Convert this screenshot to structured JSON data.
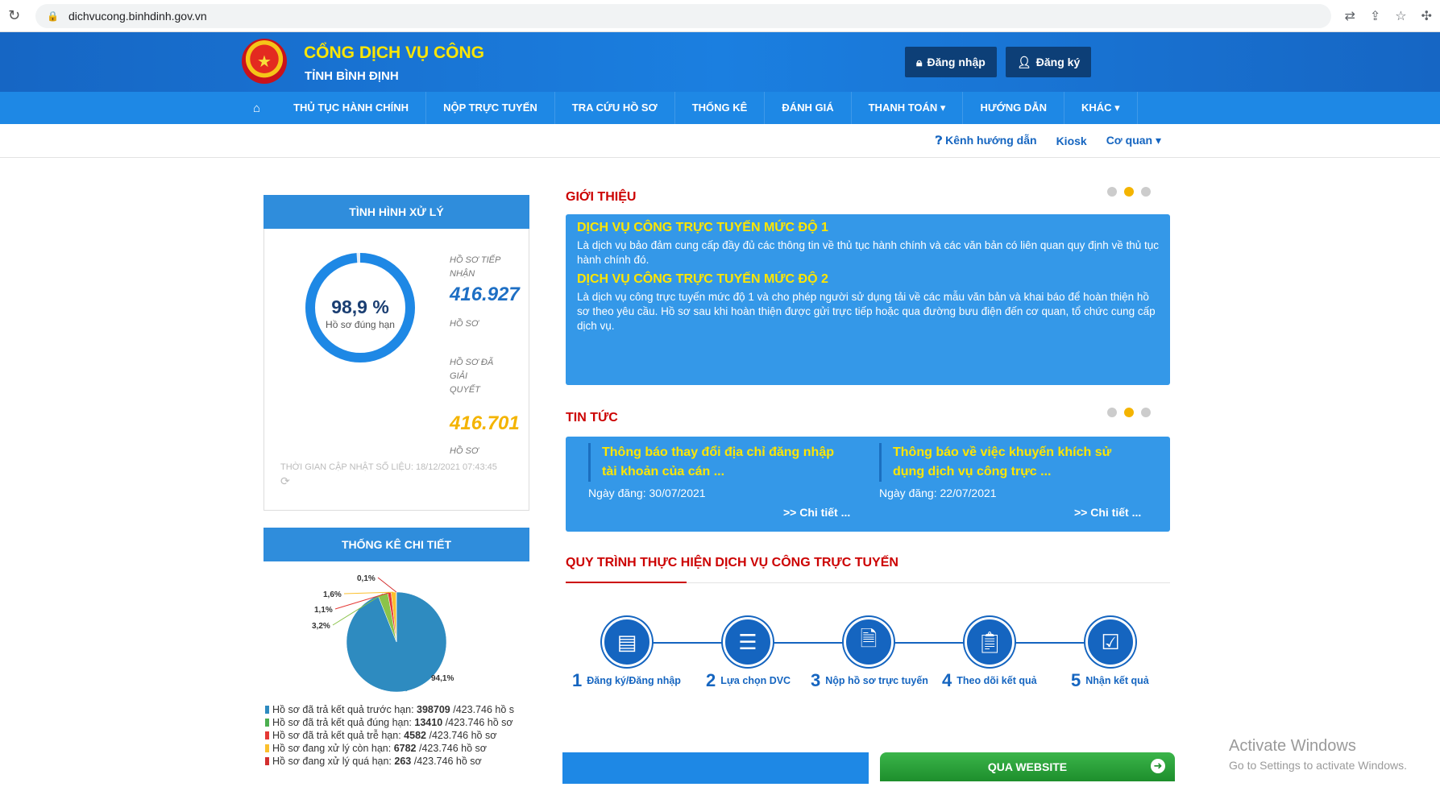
{
  "browser": {
    "url": "dichvucong.binhdinh.gov.vn"
  },
  "header": {
    "title": "CỔNG DỊCH VỤ CÔNG",
    "subtitle": "TỈNH BÌNH ĐỊNH",
    "login_label": "Đăng nhập",
    "register_label": "Đăng ký"
  },
  "nav": {
    "items": [
      "THỦ TỤC HÀNH CHÍNH",
      "NỘP TRỰC TUYẾN",
      "TRA CỨU HỒ SƠ",
      "THỐNG KÊ",
      "ĐÁNH GIÁ",
      "THANH TOÁN ▾",
      "HƯỚNG DẪN",
      "KHÁC ▾"
    ]
  },
  "subnav": {
    "guide": "Kênh hướng dẫn",
    "kiosk": "Kiosk",
    "agency": "Cơ quan ▾"
  },
  "processing": {
    "title": "TÌNH HÌNH XỬ LÝ",
    "percent_text": "98,9 %",
    "percent_value": 98.9,
    "percent_label": "Hồ sơ đúng hạn",
    "received_label": "HỒ SƠ TIẾP NHẬN",
    "received_value": "416.927",
    "received_unit": "HỒ SƠ",
    "resolved_label": "HỒ SƠ ĐÃ GIẢI QUYẾT",
    "resolved_value": "416.701",
    "resolved_unit": "HỒ SƠ",
    "update_text": "THỜI GIAN CẬP NHẬT SỐ LIỆU: 18/12/2021 07:43:45"
  },
  "stats": {
    "title": "THỐNG KÊ CHI TIẾT",
    "legend": [
      {
        "label": "Hồ sơ đã trả kết quả trước hạn:",
        "value": "398709",
        "total": "/423.746 hồ s",
        "color": "#2e8bc0"
      },
      {
        "label": "Hồ sơ đã trả kết quả đúng hạn:",
        "value": "13410",
        "total": "/423.746 hồ sơ",
        "color": "#4caf50"
      },
      {
        "label": "Hồ sơ đã trả kết quả trễ hạn:",
        "value": "4582",
        "total": "/423.746 hồ sơ",
        "color": "#e53935"
      },
      {
        "label": "Hồ sơ đang xử lý còn hạn:",
        "value": "6782",
        "total": "/423.746 hồ sơ",
        "color": "#fbc02d"
      },
      {
        "label": "Hồ sơ đang xử lý quá hạn:",
        "value": "263",
        "total": "/423.746 hồ sơ",
        "color": "#d32f2f"
      }
    ]
  },
  "chart_data": {
    "type": "pie",
    "labels": [
      "Đã trả kết quả trước hạn",
      "Đã trả kết quả đúng hạn",
      "Đã trả kết quả trễ hạn",
      "Đang xử lý còn hạn",
      "Đang xử lý quá hạn"
    ],
    "values": [
      94.1,
      3.2,
      1.1,
      1.6,
      0.1
    ],
    "value_labels": [
      "94,1%",
      "3,2%",
      "1,1%",
      "1,6%",
      "0,1%"
    ],
    "colors": [
      "#2e8bc0",
      "#8bc34a",
      "#e53935",
      "#fbc02d",
      "#d32f2f"
    ]
  },
  "intro": {
    "title": "GIỚI THIỆU",
    "h1": "DỊCH VỤ CÔNG TRỰC TUYẾN MỨC ĐỘ 1",
    "p1": "Là dịch vụ bảo đảm cung cấp đầy đủ các thông tin về thủ tục hành chính và các văn bản có liên quan quy định về thủ tục hành chính đó.",
    "h2": "DỊCH VỤ CÔNG TRỰC TUYẾN MỨC ĐỘ 2",
    "p2": "Là dịch vụ công trực tuyến mức độ 1 và cho phép người sử dụng tải về các mẫu văn bản và khai báo để hoàn thiện hồ sơ theo yêu cầu. Hồ sơ sau khi hoàn thiện được gửi trực tiếp hoặc qua đường bưu điện đến cơ quan, tổ chức cung cấp dịch vụ."
  },
  "news": {
    "title": "TIN TỨC",
    "items": [
      {
        "title": "Thông báo thay đổi địa chỉ đăng nhập tài khoản của cán ...",
        "date": "Ngày đăng: 30/07/2021",
        "more": ">> Chi tiết ..."
      },
      {
        "title": "Thông báo về việc khuyến khích sử dụng dịch vụ công trực ...",
        "date": "Ngày đăng: 22/07/2021",
        "more": ">> Chi tiết ..."
      }
    ]
  },
  "process": {
    "title": "QUY TRÌNH THỰC HIỆN DỊCH VỤ CÔNG TRỰC TUYẾN",
    "steps": [
      {
        "num": "1",
        "label": "Đăng ký/Đăng nhập",
        "icon": "id-card-icon"
      },
      {
        "num": "2",
        "label": "Lựa chọn DVC",
        "icon": "list-icon"
      },
      {
        "num": "3",
        "label": "Nộp hồ sơ trực tuyến",
        "icon": "document-icon"
      },
      {
        "num": "4",
        "label": "Theo dõi kết quả",
        "icon": "clipboard-icon"
      },
      {
        "num": "5",
        "label": "Nhận kết quả",
        "icon": "check-icon"
      }
    ]
  },
  "website_button": "QUA WEBSITE",
  "watermark": {
    "line1": "Activate Windows",
    "line2": "Go to Settings to activate Windows."
  }
}
